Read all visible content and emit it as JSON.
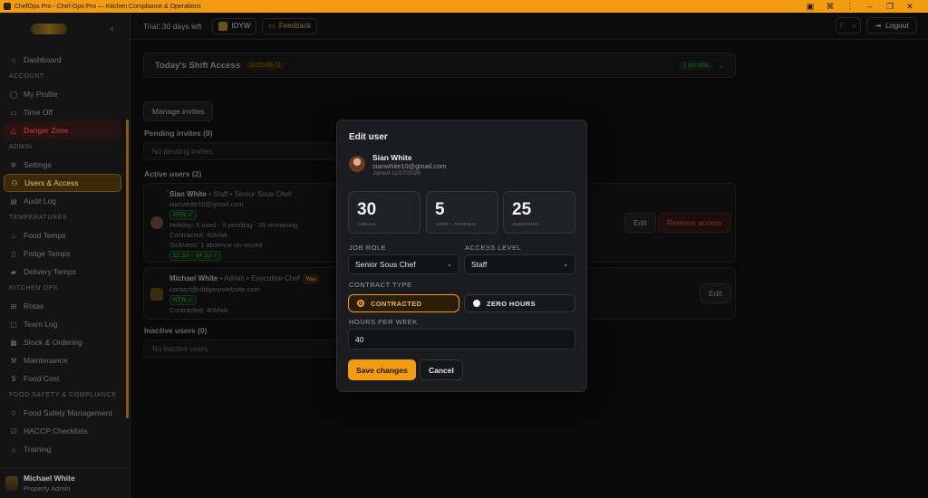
{
  "window": {
    "title": "ChefOps Pro - Chef-Ops-Pro — Kitchen Compliance & Operations"
  },
  "sidebar": {
    "items": [
      {
        "type": "item",
        "label": "Dashboard",
        "icon": "home-icon"
      },
      {
        "type": "section",
        "label": "ACCOUNT"
      },
      {
        "type": "item",
        "label": "My Profile",
        "icon": "user-icon"
      },
      {
        "type": "item",
        "label": "Time Off",
        "icon": "calendar-icon"
      },
      {
        "type": "item",
        "label": "Danger Zone",
        "icon": "warning-icon",
        "state": "danger"
      },
      {
        "type": "section",
        "label": "ADMIN"
      },
      {
        "type": "item",
        "label": "Settings",
        "icon": "gear-icon"
      },
      {
        "type": "item",
        "label": "Users & Access",
        "icon": "users-icon",
        "state": "active"
      },
      {
        "type": "item",
        "label": "Audit Log",
        "icon": "document-icon"
      },
      {
        "type": "section",
        "label": "TEMPERATURES"
      },
      {
        "type": "item",
        "label": "Food Temps",
        "icon": "thermometer-icon"
      },
      {
        "type": "item",
        "label": "Fridge Temps",
        "icon": "fridge-icon"
      },
      {
        "type": "item",
        "label": "Delivery Temps",
        "icon": "truck-icon"
      },
      {
        "type": "section",
        "label": "KITCHEN OPS"
      },
      {
        "type": "item",
        "label": "Rotas",
        "icon": "rota-icon"
      },
      {
        "type": "item",
        "label": "Team Log",
        "icon": "chat-icon"
      },
      {
        "type": "item",
        "label": "Stock & Ordering",
        "icon": "box-icon"
      },
      {
        "type": "item",
        "label": "Maintenance",
        "icon": "wrench-icon"
      },
      {
        "type": "item",
        "label": "Food Cost",
        "icon": "cost-icon"
      },
      {
        "type": "section",
        "label": "FOOD SAFETY & COMPLIANCE"
      },
      {
        "type": "item",
        "label": "Food Safety Management",
        "icon": "shield-icon"
      },
      {
        "type": "item",
        "label": "HACCP Checklists",
        "icon": "checklist-icon"
      },
      {
        "type": "item",
        "label": "Training",
        "icon": "graduation-icon"
      }
    ],
    "user": {
      "name": "Michael White",
      "role": "Property Admin"
    }
  },
  "header": {
    "trial": "Trial: 30 days left",
    "org_code": "IDYW",
    "feedback": "Feedback",
    "logout": "Logout"
  },
  "main": {
    "shift": {
      "title": "Today's Shift Access",
      "date": "2026-06-11",
      "badge": "1 on rota"
    },
    "manage_invites": "Manage invites",
    "pending_title": "Pending invites (0)",
    "pending_empty": "No pending invites.",
    "active_title": "Active users (2)",
    "users": [
      {
        "name": "Sian White",
        "meta": "• Staff  • Senior Sous Chef",
        "email": "sianwhite10@gmail.com",
        "rtw": "RTW ✓",
        "holiday": "Holiday: 5 used · 0 pending · 25 remaining",
        "contracted": "Contracted: 40h/wk",
        "sickness": "Sickness: 1 absence on record",
        "leave_tag": "12 Jul – 14 Jul ✓",
        "edit": "Edit",
        "remove": "Remove access"
      },
      {
        "name": "Michael White",
        "meta": "• Admin  • Executive Chef",
        "you": "You",
        "email": "contact@ididyourwebsite.com",
        "rtw": "RTW ✓",
        "contracted": "Contracted: 40h/wk",
        "edit": "Edit"
      }
    ],
    "inactive_title": "Inactive users (0)",
    "inactive_empty": "No inactive users."
  },
  "modal": {
    "title": "Edit user",
    "user": {
      "name": "Sian White",
      "email": "sianwhite10@gmail.com",
      "joined": "Joined 11/07/2026"
    },
    "stats": [
      {
        "value": "30",
        "label": "ANNUAL"
      },
      {
        "value": "5",
        "label": "USED + PENDING"
      },
      {
        "value": "25",
        "label": "REMAINING"
      }
    ],
    "job_role_label": "JOB ROLE",
    "job_role_value": "Senior Sous Chef",
    "access_level_label": "ACCESS LEVEL",
    "access_level_value": "Staff",
    "contract_type_label": "CONTRACT TYPE",
    "contract_options": [
      {
        "label": "CONTRACTED",
        "selected": true
      },
      {
        "label": "ZERO HOURS",
        "selected": false
      }
    ],
    "hours_label": "HOURS PER WEEK",
    "hours_value": "40",
    "save": "Save changes",
    "cancel": "Cancel"
  },
  "colors": {
    "accent": "#f39c12",
    "danger": "#c74040",
    "success": "#3c8a48"
  }
}
